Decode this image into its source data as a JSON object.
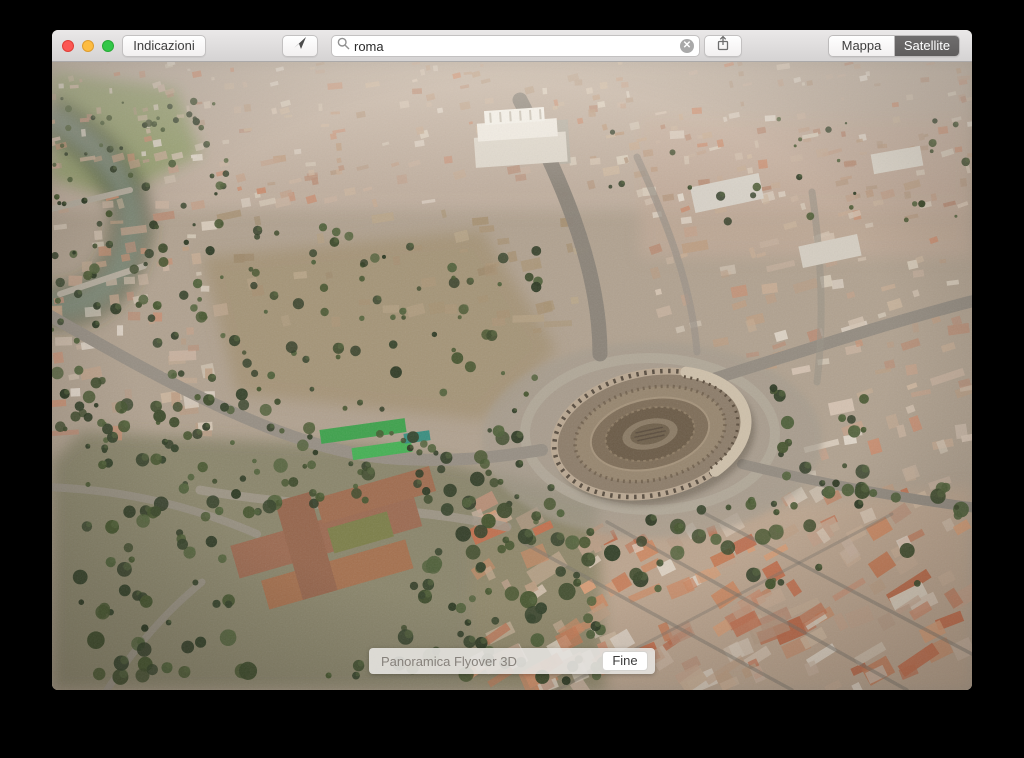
{
  "window": {
    "traffic_lights": [
      {
        "name": "close",
        "color": "#fc5753"
      },
      {
        "name": "minimize",
        "color": "#fdbc40"
      },
      {
        "name": "zoom",
        "color": "#33c748"
      }
    ]
  },
  "toolbar": {
    "directions_label": "Indicazioni",
    "location_icon": "location-arrow",
    "search": {
      "value": "roma",
      "icon": "magnifier",
      "clear_icon": "x"
    },
    "share_icon": "share-arrow-up",
    "segments": [
      {
        "label": "Mappa",
        "selected": false
      },
      {
        "label": "Satellite",
        "selected": true
      }
    ]
  },
  "flyover_bar": {
    "title": "Panoramica Flyover 3D",
    "done_label": "Fine"
  },
  "colors": {
    "selected_segment_bg": "#666364",
    "toolbar_bg": "#e0dede",
    "flyover_bar_bg": "#e5e3e0",
    "map_base": "#b1a290"
  }
}
